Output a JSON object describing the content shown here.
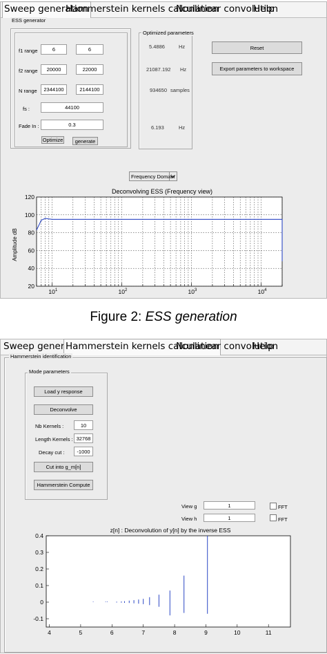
{
  "figure2": {
    "tabs": [
      "Sweep generation",
      "Hammerstein kernels calculation",
      "Nonlinear convolution",
      "Help"
    ],
    "ess_panel": {
      "title": "ESS generator",
      "rows": [
        {
          "label": "f1 range",
          "v1": "6",
          "v2": "6"
        },
        {
          "label": "f2 range",
          "v1": "20000",
          "v2": "22000"
        },
        {
          "label": "N range",
          "v1": "2344100",
          "v2": "2144100"
        }
      ],
      "fs_label": "fs :",
      "fs_value": "44100",
      "fade_label": "Fade In :",
      "fade_value": "0.3",
      "optimize_label": "Optimize",
      "generate_label": "generate"
    },
    "opt_panel": {
      "title": "Optimized parameters",
      "rows": [
        {
          "value": "5.4886",
          "unit": "Hz"
        },
        {
          "value": "21087.192",
          "unit": "Hz"
        },
        {
          "value": "934650",
          "unit": "samples"
        },
        {
          "value": "6.193",
          "unit": "Hz"
        }
      ]
    },
    "reset_label": "Reset",
    "export_label": "Export parameters to workspace",
    "dropdown_value": "Frequency Domain",
    "chart": {
      "title": "Deconvolving ESS (Frequency view)",
      "ylabel": "Amplitude dB",
      "yticks": [
        "120",
        "100",
        "80",
        "60",
        "40",
        "20"
      ],
      "xticks": [
        {
          "base": "10",
          "exp": "1"
        },
        {
          "base": "10",
          "exp": "2"
        },
        {
          "base": "10",
          "exp": "3"
        },
        {
          "base": "10",
          "exp": "4"
        }
      ]
    },
    "caption_prefix": "Figure 2:",
    "caption_italic": "ESS generation"
  },
  "figure3": {
    "tabs": [
      "Sweep generation",
      "Hammerstein kernels calculation",
      "Nonlinear convolution",
      "Help"
    ],
    "panel_title": "Hammerstein identification",
    "mode_title": "Mode parameters",
    "load_label": "Load y response",
    "deconvolve_label": "Deconvolve",
    "params": [
      {
        "label": "Nb Kernels :",
        "value": "10"
      },
      {
        "label": "Length Kernels :",
        "value": "32768"
      },
      {
        "label": "Decay cut :",
        "value": "-1000"
      }
    ],
    "cut_label": "Cut into g_m[n]",
    "compute_label": "Hammerstein Compute",
    "view_g_label": "View g",
    "view_g_value": "1",
    "view_h_label": "View h",
    "view_h_value": "1",
    "fft_label": "FFT",
    "chart": {
      "title": "z[n] : Deconvolution of y[n] by the inverse ESS",
      "yticks": [
        "0.4",
        "0.3",
        "0.2",
        "0.1",
        "0",
        "-0.1"
      ],
      "xticks": [
        "4",
        "5",
        "6",
        "7",
        "8",
        "9",
        "10",
        "11"
      ]
    }
  },
  "chart_data": [
    {
      "type": "line",
      "title": "Deconvolving ESS (Frequency view)",
      "xlabel": "",
      "ylabel": "Amplitude dB",
      "xscale": "log",
      "xlim": [
        6,
        20000
      ],
      "ylim": [
        20,
        120
      ],
      "grid": true,
      "series": [
        {
          "x": [
            6,
            7,
            8,
            10,
            100,
            1000,
            10000,
            19000,
            20000,
            20000
          ],
          "y": [
            83,
            94,
            96,
            95,
            95,
            95,
            95,
            95,
            95,
            48
          ]
        }
      ]
    },
    {
      "type": "bar",
      "title": "z[n] : Deconvolution of y[n] by the inverse ESS",
      "xlim": [
        3.9,
        11.7
      ],
      "ylim": [
        -0.15,
        0.4
      ],
      "grid": false,
      "x": [
        5.4,
        5.8,
        5.85,
        6.15,
        6.3,
        6.4,
        6.55,
        6.7,
        6.85,
        7.0,
        7.2,
        7.5,
        7.85,
        8.3,
        9.05
      ],
      "values": [
        0.003,
        0.003,
        0.003,
        0.003,
        0.004,
        0.006,
        0.009,
        0.012,
        0.016,
        0.02,
        0.03,
        0.045,
        0.07,
        0.16,
        0.4
      ],
      "neg_values": [
        0,
        0,
        0,
        -0.002,
        -0.003,
        -0.004,
        -0.005,
        -0.007,
        -0.009,
        -0.012,
        -0.018,
        -0.028,
        -0.08,
        -0.065,
        -0.07
      ]
    }
  ]
}
